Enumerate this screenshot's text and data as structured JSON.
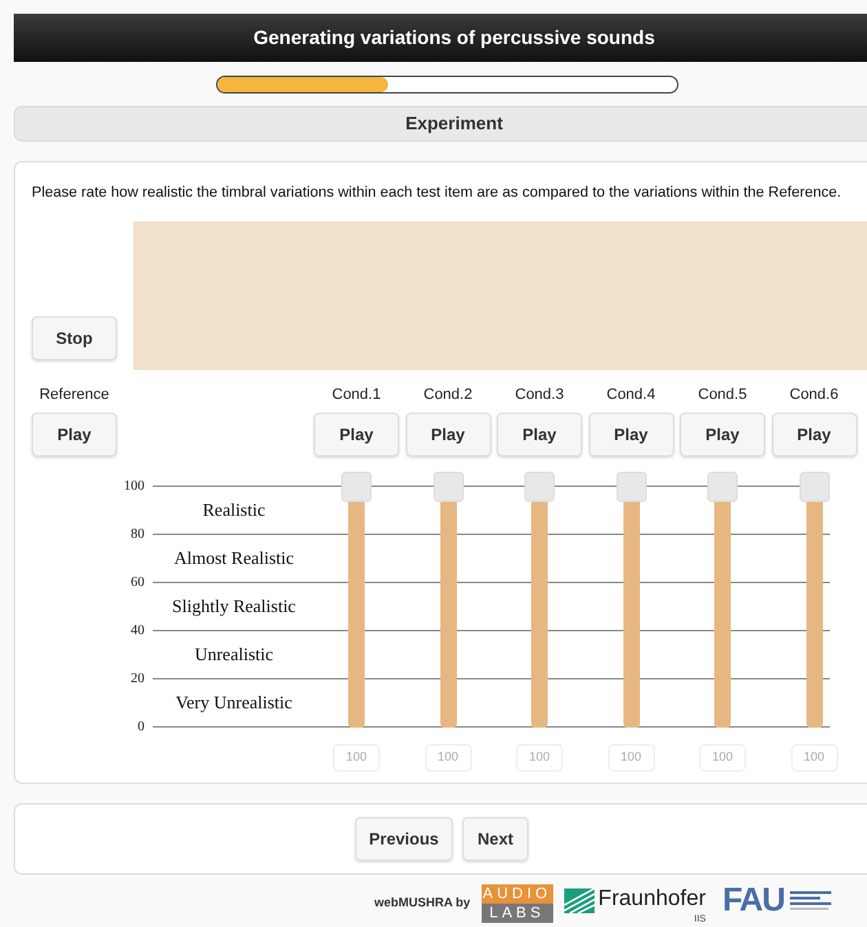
{
  "header": {
    "title": "Generating variations of percussive sounds"
  },
  "progress": {
    "level": 0.37
  },
  "section": {
    "title": "Experiment"
  },
  "instruction": "Please rate how realistic the timbral variations within each test item are as compared to the variations within the Reference.",
  "stop_button": "Stop",
  "reference": {
    "label": "Reference",
    "button": "Play"
  },
  "scale": {
    "ticks": [
      "100",
      "80",
      "60",
      "40",
      "20",
      "0"
    ],
    "labels": [
      "Realistic",
      "Almost Realistic",
      "Slightly Realistic",
      "Unrealistic",
      "Very Unrealistic"
    ]
  },
  "conditions": [
    {
      "label": "Cond.1",
      "button": "Play",
      "level": 1,
      "value": "100"
    },
    {
      "label": "Cond.2",
      "button": "Play",
      "level": 1,
      "value": "100"
    },
    {
      "label": "Cond.3",
      "button": "Play",
      "level": 1,
      "value": "100"
    },
    {
      "label": "Cond.4",
      "button": "Play",
      "level": 1,
      "value": "100"
    },
    {
      "label": "Cond.5",
      "button": "Play",
      "level": 1,
      "value": "100"
    },
    {
      "label": "Cond.6",
      "button": "Play",
      "level": 1,
      "value": "100"
    }
  ],
  "navigation": [
    "Previous",
    "Next"
  ],
  "footer": {
    "credit": "webMUSHRA by",
    "audiolabs": [
      "AUDIO",
      "LABS"
    ],
    "fraunhofer": "Fraunhofer",
    "fraunhofer_sub": "IIS",
    "fau": "FAU"
  }
}
